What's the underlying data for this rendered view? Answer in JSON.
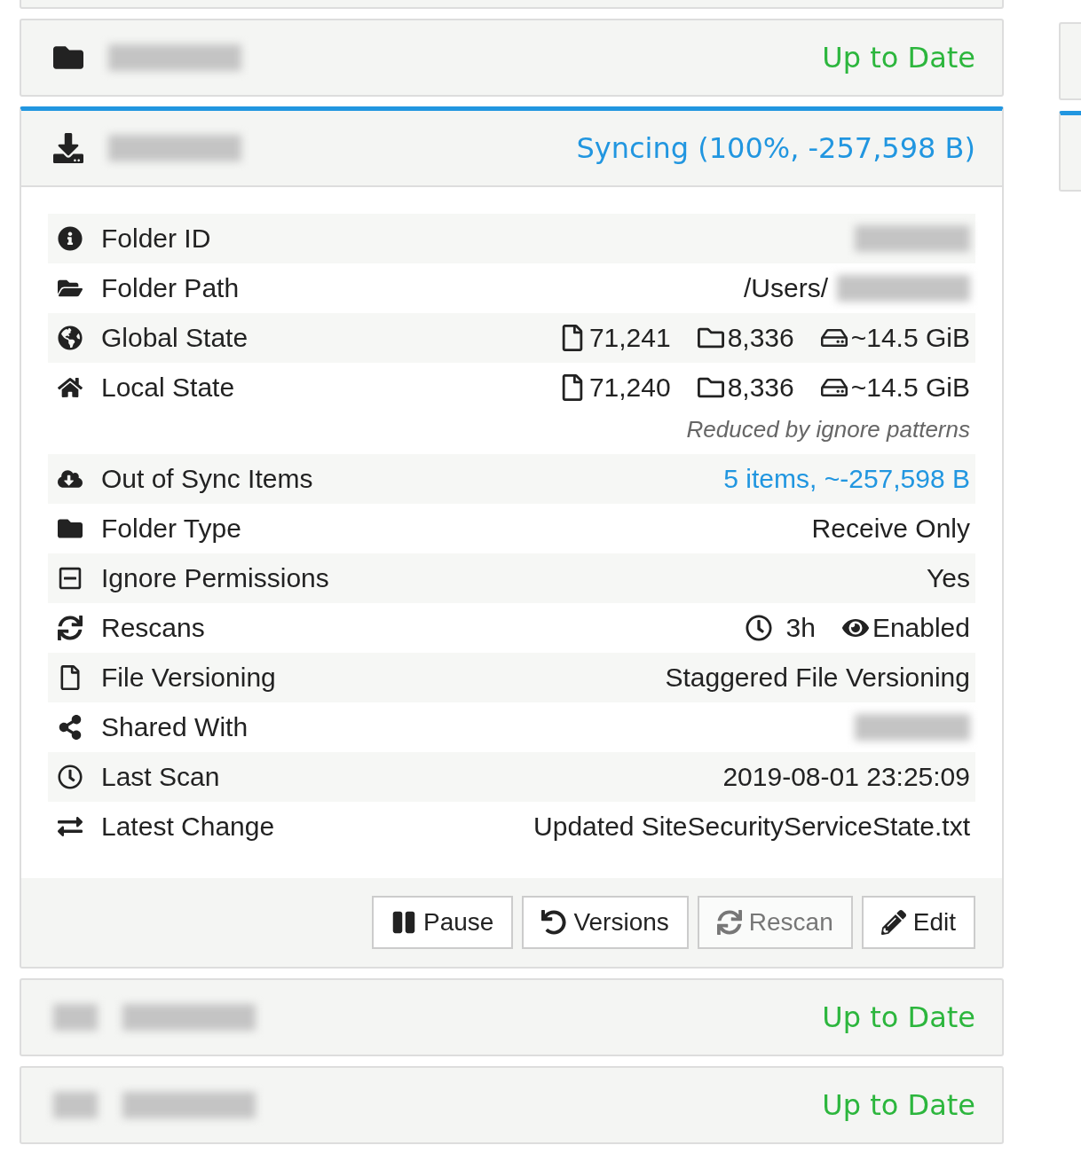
{
  "folders": [
    {
      "kind": "idle",
      "status": "Up to Date"
    },
    {
      "kind": "syncing",
      "status": "Syncing (100%, -257,598 B)",
      "details": [
        {
          "kind": "redacted",
          "label": "Folder ID"
        },
        {
          "kind": "path",
          "label": "Folder Path",
          "value": "/Users/"
        },
        {
          "kind": "counts",
          "label": "Global State",
          "files": "71,241",
          "dirs": "8,336",
          "size": "~14.5 GiB"
        },
        {
          "kind": "counts",
          "label": "Local State",
          "files": "71,240",
          "dirs": "8,336",
          "size": "~14.5 GiB",
          "note": "Reduced by ignore patterns"
        },
        {
          "kind": "link",
          "label": "Out of Sync Items",
          "value": "5 items, ~-257,598 B"
        },
        {
          "kind": "text",
          "label": "Folder Type",
          "value": "Receive Only"
        },
        {
          "kind": "text",
          "label": "Ignore Permissions",
          "value": "Yes"
        },
        {
          "kind": "rescans",
          "label": "Rescans",
          "interval": "3h",
          "watcher": "Enabled"
        },
        {
          "kind": "text",
          "label": "File Versioning",
          "value": "Staggered File Versioning"
        },
        {
          "kind": "redacted",
          "label": "Shared With"
        },
        {
          "kind": "text",
          "label": "Last Scan",
          "value": "2019-08-01 23:25:09"
        },
        {
          "kind": "text",
          "label": "Latest Change",
          "value": "Updated SiteSecurityServiceState.txt"
        }
      ],
      "buttons": [
        {
          "label": "Pause",
          "disabled": false
        },
        {
          "label": "Versions",
          "disabled": false
        },
        {
          "label": "Rescan",
          "disabled": true
        },
        {
          "label": "Edit",
          "disabled": false
        }
      ]
    },
    {
      "kind": "idle",
      "status": "Up to Date"
    },
    {
      "kind": "idle",
      "status": "Up to Date"
    }
  ]
}
